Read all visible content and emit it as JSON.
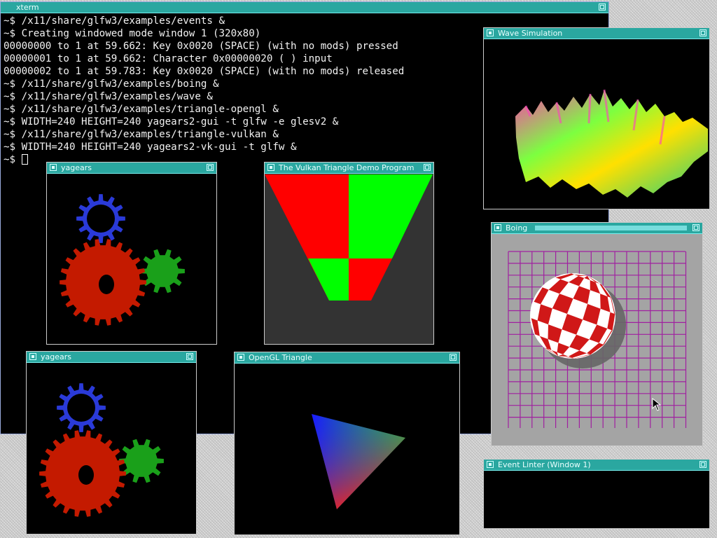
{
  "xterm": {
    "title": "xterm",
    "lines": [
      "~$ /x11/share/glfw3/examples/events &",
      "~$ Creating windowed mode window 1 (320x80)",
      "00000000 to 1 at 59.662: Key 0x0020 (SPACE) (with no mods) pressed",
      "00000001 to 1 at 59.662: Character 0x00000020 ( ) input",
      "00000002 to 1 at 59.783: Key 0x0020 (SPACE) (with no mods) released",
      "~$ /x11/share/glfw3/examples/boing &",
      "~$ /x11/share/glfw3/examples/wave &",
      "~$ /x11/share/glfw3/examples/triangle-opengl &",
      "~$ WIDTH=240 HEIGHT=240 yagears2-gui -t glfw -e glesv2 &",
      "~$ /x11/share/glfw3/examples/triangle-vulkan &",
      "~$ WIDTH=240 HEIGHT=240 yagears2-vk-gui -t glfw &"
    ],
    "prompt": "~$ "
  },
  "windows": {
    "yagears1": {
      "title": "yagears"
    },
    "vulkan": {
      "title": "The Vulkan Triangle Demo Program"
    },
    "wave": {
      "title": "Wave Simulation"
    },
    "boing": {
      "title": "Boing"
    },
    "yagears2": {
      "title": "yagears"
    },
    "opengl": {
      "title": "OpenGL Triangle"
    },
    "linter": {
      "title": "Event Linter (Window 1)"
    }
  },
  "colors": {
    "titlebar": "#2aa7a0",
    "gear_red": "#c41a00",
    "gear_green": "#1aa01a",
    "gear_blue": "#2a3ad8",
    "vk_red": "#ff0000",
    "vk_green": "#00ff00",
    "boing_grid": "#a020a0",
    "boing_bg": "#a4a4a4"
  }
}
